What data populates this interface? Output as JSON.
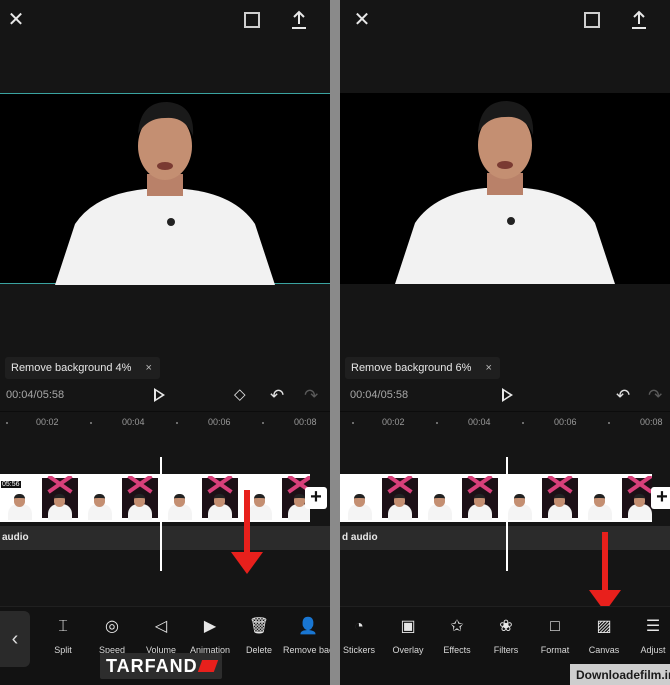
{
  "left_panel": {
    "chip_label": "Remove background 4%",
    "chip_close": "×",
    "time": "00:04/05:58",
    "ticks": [
      "00:02",
      "00:04",
      "00:06",
      "00:08"
    ],
    "timecode": "05:56",
    "audio_label": "audio",
    "tools": [
      {
        "label": "Split",
        "icon": "split-icon",
        "glyph": "⌶"
      },
      {
        "label": "Speed",
        "icon": "speed-icon",
        "glyph": "◎"
      },
      {
        "label": "Volume",
        "icon": "volume-icon",
        "glyph": "◁"
      },
      {
        "label": "Animation",
        "icon": "animation-icon",
        "glyph": "▶"
      },
      {
        "label": "Delete",
        "icon": "delete-icon",
        "glyph": "🗑"
      },
      {
        "label": "Remove background",
        "icon": "remove-background-icon",
        "glyph": "👤"
      }
    ],
    "back_glyph": "‹"
  },
  "right_panel": {
    "chip_label": "Remove background 6%",
    "chip_close": "×",
    "time": "00:04/05:58",
    "ticks": [
      "00:02",
      "00:04",
      "00:06",
      "00:08"
    ],
    "audio_label": "d audio",
    "tools": [
      {
        "label": "Stickers",
        "icon": "stickers-icon",
        "glyph": "◔"
      },
      {
        "label": "Overlay",
        "icon": "overlay-icon",
        "glyph": "▣"
      },
      {
        "label": "Effects",
        "icon": "effects-icon",
        "glyph": "✩"
      },
      {
        "label": "Filters",
        "icon": "filters-icon",
        "glyph": "❀"
      },
      {
        "label": "Format",
        "icon": "format-icon",
        "glyph": "□"
      },
      {
        "label": "Canvas",
        "icon": "canvas-icon",
        "glyph": "▨"
      },
      {
        "label": "Adjust",
        "icon": "adjust-icon",
        "glyph": "☰"
      }
    ]
  },
  "watermarks": {
    "tarfand": "TARFAND",
    "downloadfilm": "Downloadefilm.ir"
  },
  "colors": {
    "accent_arrow": "#e8201c",
    "background": "#151515",
    "preview_border": "#3aa3a0"
  }
}
